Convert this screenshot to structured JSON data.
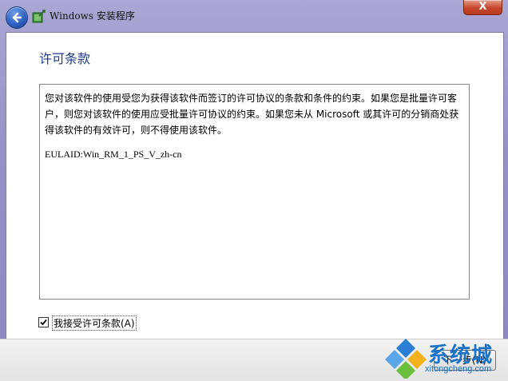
{
  "window": {
    "title": "Windows 安装程序",
    "close_label": "X"
  },
  "page": {
    "heading": "许可条款",
    "license_text": "您对该软件的使用受您为获得该软件而签订的许可协议的条款和条件的约束。如果您是批量许可客户，则您对该软件的使用应受批量许可协议的约束。如果您未从 Microsoft 或其许可的分销商处获得该软件的有效许可，则不得使用该软件。",
    "eula_id": "EULAID:Win_RM_1_PS_V_zh-cn",
    "accept_checkbox": {
      "label": "我接受许可条款(A)",
      "checked": true
    }
  },
  "footer": {
    "next_label": "下一步(N)"
  },
  "watermark": {
    "brand": "系统城",
    "url": "xitongcheng.com"
  },
  "colors": {
    "heading": "#1e3a8c",
    "frame": "#9692c6",
    "watermark": "#1a73c9"
  }
}
